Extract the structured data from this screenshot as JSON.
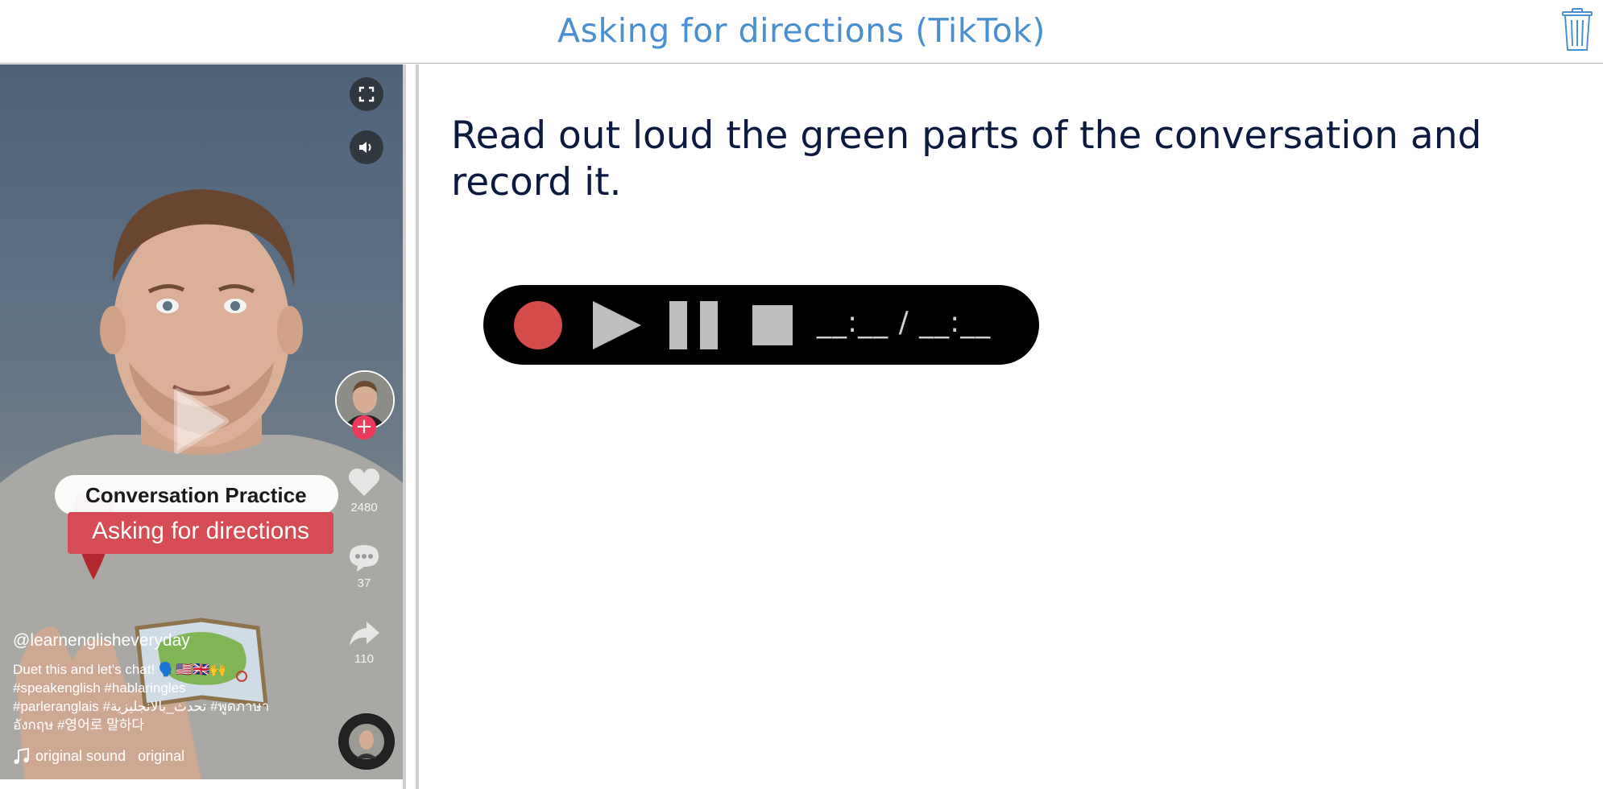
{
  "header": {
    "title": "Asking for directions (TikTok)",
    "delete_icon": "trash-icon"
  },
  "video": {
    "overlay_title": "Conversation Practice",
    "overlay_subtitle": "Asking for directions",
    "username": "@learnenglisheveryday",
    "caption_line1": "Duet this and let's chat! 🗣️🇺🇸🇬🇧🙌",
    "caption_line2": "#speakenglish #hablaringles",
    "caption_line3": "#parleranglais #تحدث_بالانجليزية #พูดภาษา",
    "caption_line4": "อังกฤษ #영어로 말하다",
    "sound": "original sound   original",
    "likes": "2480",
    "comments": "37",
    "shares": "110",
    "icons": [
      "fullscreen-icon",
      "volume-icon",
      "play-icon",
      "heart-icon",
      "comment-icon",
      "share-icon",
      "music-note-icon"
    ]
  },
  "main": {
    "instruction": "Read out loud the green parts of the conversation and record it."
  },
  "recorder": {
    "time_display": "__:__ / __:__",
    "record_color": "#d34b4b",
    "controls": [
      "record",
      "play",
      "pause",
      "stop"
    ]
  }
}
